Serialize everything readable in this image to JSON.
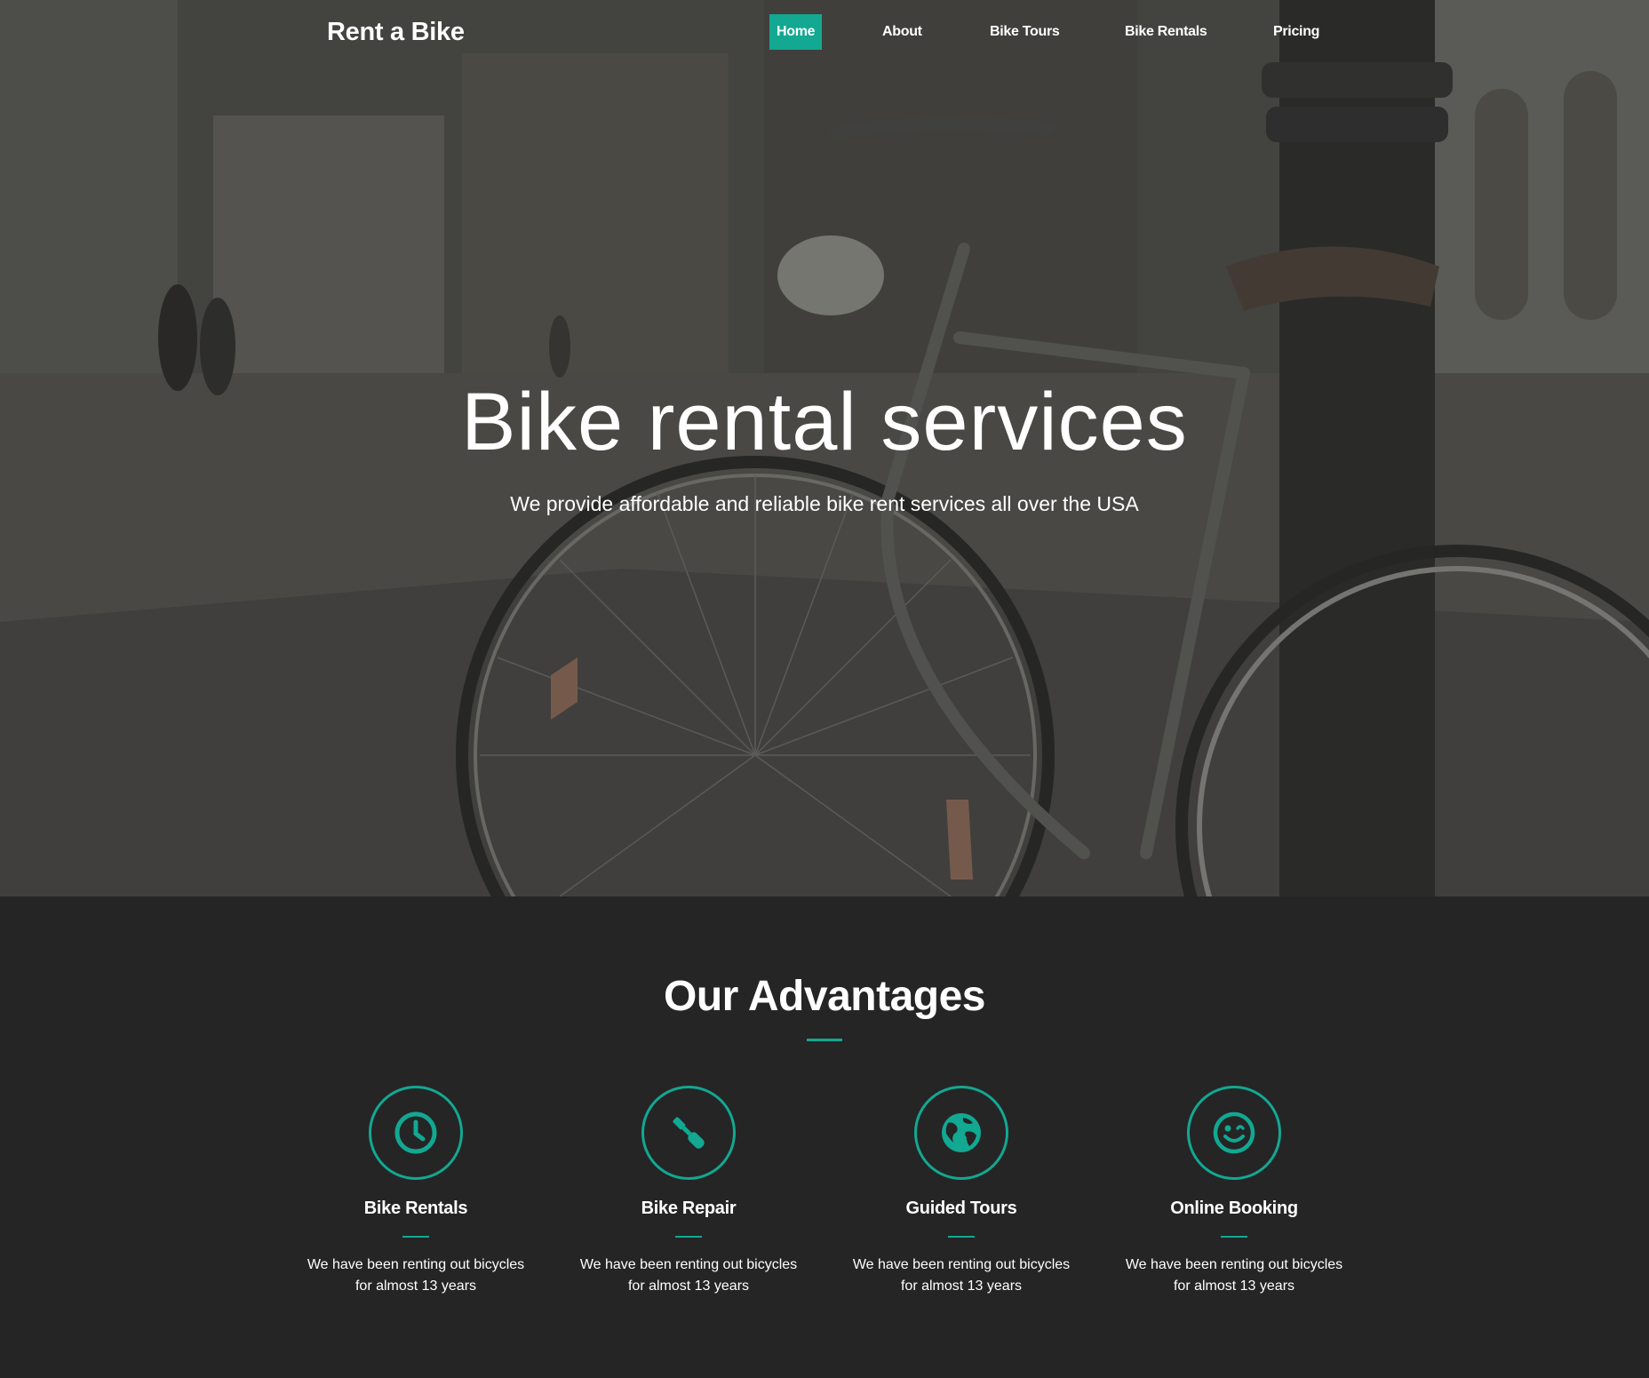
{
  "brand": {
    "name": "Rent a Bike",
    "accent_color": "#12a892"
  },
  "nav": {
    "items": [
      {
        "label": "Home",
        "active": true
      },
      {
        "label": "About",
        "active": false
      },
      {
        "label": "Bike Tours",
        "active": false
      },
      {
        "label": "Bike Rentals",
        "active": false
      },
      {
        "label": "Pricing",
        "active": false
      }
    ]
  },
  "hero": {
    "title": "Bike rental services",
    "subtitle": "We provide affordable and reliable bike rent services all over the USA",
    "background": "bicycle-photo"
  },
  "advantages": {
    "title": "Our Advantages",
    "items": [
      {
        "icon": "clock-icon",
        "title": "Bike Rentals",
        "text": "We have been renting out bicycles for almost 13 years"
      },
      {
        "icon": "wrench-icon",
        "title": "Bike Repair",
        "text": "We have been renting out bicycles for almost 13 years"
      },
      {
        "icon": "globe-icon",
        "title": "Guided Tours",
        "text": "We have been renting out bicycles for almost 13 years"
      },
      {
        "icon": "wink-smiley-icon",
        "title": "Online Booking",
        "text": "We have been renting out bicycles for almost 13 years"
      }
    ]
  }
}
